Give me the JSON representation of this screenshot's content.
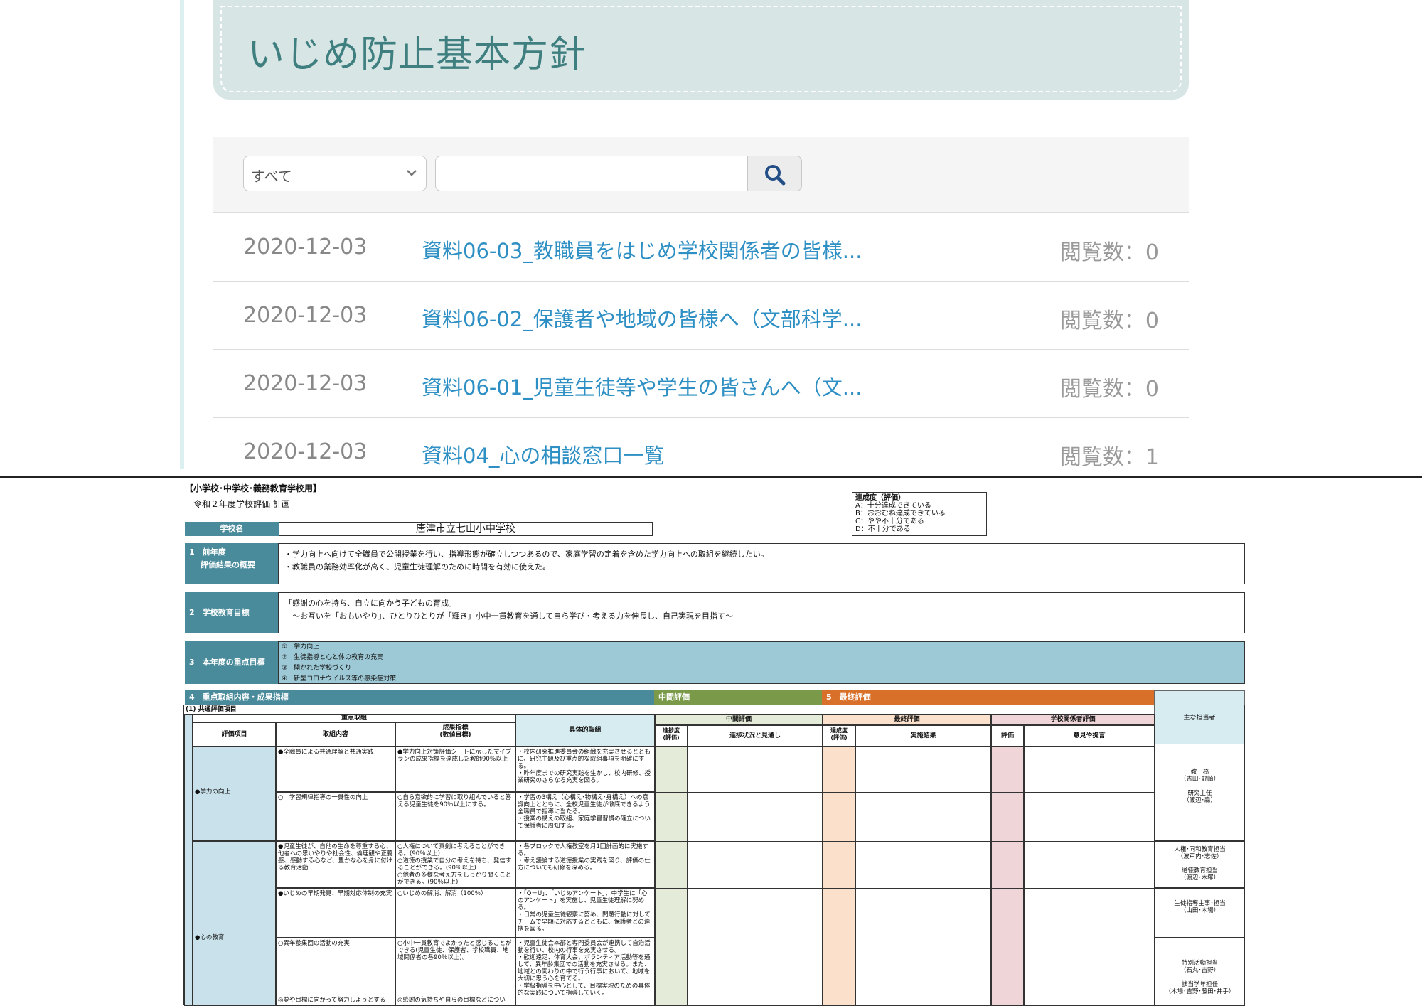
{
  "page": {
    "title": "いじめ防止基本方針"
  },
  "search": {
    "category_selected": "すべて",
    "search_placeholder": ""
  },
  "documents": [
    {
      "date": "2020-12-03",
      "title": "資料06-03_教職員をはじめ学校関係者の皆様...",
      "views": "閲覧数：0"
    },
    {
      "date": "2020-12-03",
      "title": "資料06-02_保護者や地域の皆様へ（文部科学...",
      "views": "閲覧数：0"
    },
    {
      "date": "2020-12-03",
      "title": "資料06-01_児童生徒等や学生の皆さんへ（文...",
      "views": "閲覧数：0"
    },
    {
      "date": "2020-12-03",
      "title": "資料04_心の相談窓口一覧",
      "views": "閲覧数：1"
    }
  ],
  "preview": {
    "heading": "【小学校･中学校･義務教育学校用】",
    "subheading": "令和２年度学校評価 計画",
    "legend": {
      "title": "達成度（評価）",
      "items": [
        "A：十分達成できている",
        "B：おおむね達成できている",
        "C：やや不十分である",
        "D：不十分である"
      ]
    },
    "school": {
      "label": "学校名",
      "value": "唐津市立七山小中学校"
    },
    "s1": {
      "label1": "1　前年度",
      "label2": "評価結果の概要",
      "lines": [
        "・学力向上へ向けて全職員で公開授業を行い、指導形態が確立しつつあるので、家庭学習の定着を含めた学力向上への取組を継続したい。",
        "・教職員の業務効率化が高く、児童生徒理解のために時間を有効に使えた。"
      ]
    },
    "s2": {
      "label": "2　学校教育目標",
      "lines": [
        "「感謝の心を持ち、自立に向かう子どもの育成」",
        "　～お互いを「おもいやり」、ひとりひとりが「輝き」小中一貫教育を通して自ら学び・考える力を伸長し、自己実現を目指す～"
      ]
    },
    "s3": {
      "label": "3　本年度の重点目標",
      "lines": [
        "①　学力向上",
        "②　生徒指導と心と体の教育の充実",
        "③　開かれた学校づくり",
        "④　新型コロナウイルス等の感染症対策"
      ]
    },
    "s4": {
      "label": "4　重点取組内容・成果指標",
      "mid": "中間評価",
      "final": "5　最終評価",
      "staff": "主な担当者"
    },
    "grid": {
      "common": "(1) 共通評価項目",
      "h_focus": "重点取組",
      "h_item": "評価項目",
      "h_content": "取組内容",
      "h_index": "成果指標\n(数値目標)",
      "h_specific": "具体的取組",
      "h_mid": "中間評価",
      "h_final": "最終評価",
      "h_stake": "学校関係者評価",
      "h_prog": "進捗度\n(評価)",
      "h_prog2": "進捗状況と見通し",
      "h_ach": "達成度\n(評価)",
      "h_res": "実施結果",
      "h_eval": "評価",
      "h_op": "意見や提言",
      "item1": "●学力の向上",
      "item2": "●心の教育",
      "r1c": "●全職員による共通理解と共通実践",
      "r1i": "●学力向上対策評価シートに示したマイプランの成果指標を達成した教師90％以上",
      "r1s": "・校内研究推進委員会の組織を充実させるとともに、研究主題及び重点的な取組事項を明確にする。\n・昨年度までの研究実践を生かし、校内研修、授業研究のさらなる充実を図る。",
      "r2c": "○　学習規律指導の一貫性の向上",
      "r2i": "○自ら意欲的に学習に取り組んでいると答える児童生徒を90％以上にする。",
      "r2s": "・学習の3構え（心構え･物構え･身構え）への意識向上とともに、全校児童生徒が徹底できるよう全職員で指導に当たる。\n・授業の構えの取組、家庭学習習慣の確立について保護者に周知する。",
      "staff1": "教　務\n（吉田･野崎）\n\n研究主任\n（渡辺･森）",
      "r3c": "●児童生徒が、自他の生命を尊重する心、他者への思いやりや社会性、倫理観や正義感、感動する心など、豊かな心を身に付ける教育活動",
      "r3i": "○人権について真剣に考えることができる。(90％以上)\n○道徳の授業で自分の考えを持ち、発信することができる。(90％以上)\n○他者の多様な考え方をしっかり聞くことができる。(90％以上)",
      "r3s": "・各ブロックで人権教室を月1回計画的に実施する。\n・考え議論する道徳授業の実践を図り、評価の仕方についても研修を深める。",
      "staff2": "人権･同和教育担当\n（波戸内･志佐）\n\n道徳教育担当\n（渡辺･木塚）",
      "r4c": "●いじめの早期発見、早期対応体制の充実",
      "r4i": "○いじめの解消、解消（100％）",
      "r4s": "・「Q－U」、「いじめアンケート」、中学生に「心のアンケート」を実施し、児童生徒理解に努める。\n・日常の児童生徒観察に努め、問題行動に対してチームで早期に対応するとともに、保護者との連携を図る。",
      "staff3": "生徒指導主事･担当\n（山田･木場）",
      "r5c": "○異年齢集団の活動の充実",
      "r5i": "○小中一貫教育でよかったと感じることができる(児童生徒、保護者、学校職員、地域関係者の各90％以上)。",
      "r5s": "・児童生徒会本部と専門委員会が連携して自治活動を行い、校内の行事を充実させる。\n・歓迎遠足、体育大会、ボランティア活動等を通して、異年齢集団での活動を充実させる。また、地域との関わりの中で行う行事において、地域を大切に思う心を育てる。\n・学級指導を中心として、目標実現のための具体的な実践について指導していく。",
      "staff4": "特別活動担当\n（石丸･吉野）\n\n該当学年担任\n（木場･吉野･藤田･井手）",
      "r6c": "◎夢や目標に向かって努力しようとする",
      "r6i": "◎感謝の気持ちや自らの目標などについ"
    }
  }
}
